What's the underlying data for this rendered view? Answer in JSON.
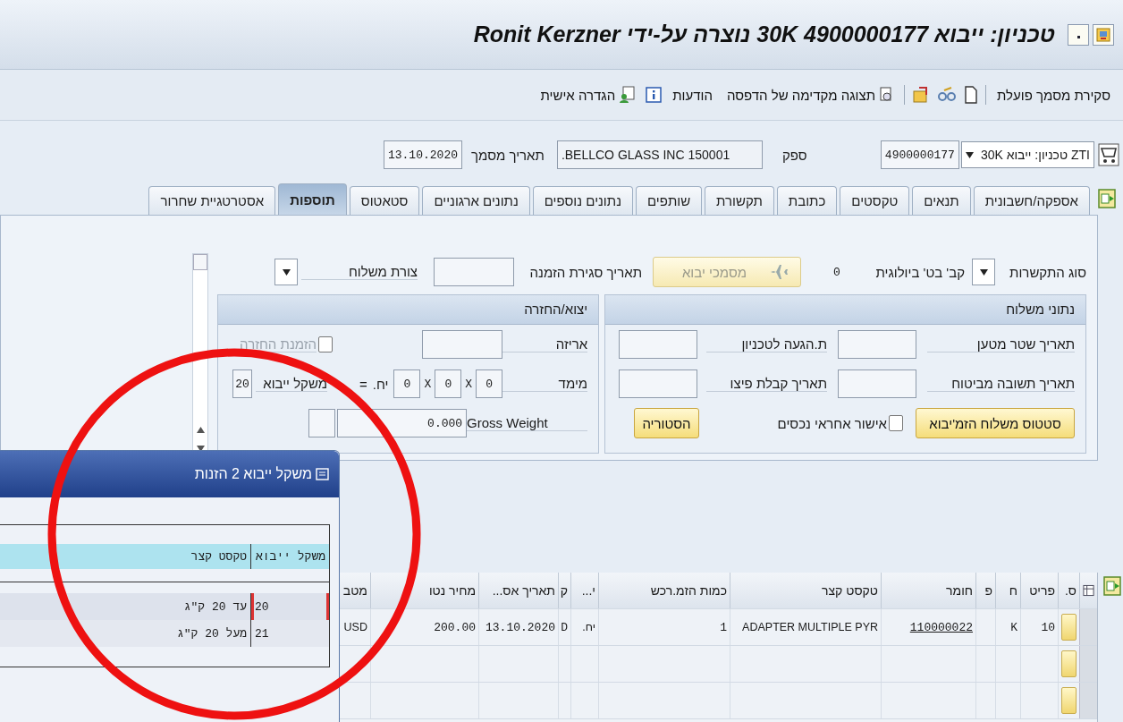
{
  "window": {
    "title": "טכניון: ייבוא 30K 4900000177 נוצרה על-ידי Ronit Kerzner"
  },
  "toolbar": {
    "document_overview": "סקירת מסמך פועלת",
    "print_preview": "תצוגה מקדימה של הדפסה",
    "messages": "הודעות",
    "personal_setting": "הגדרה אישית"
  },
  "header": {
    "doc_type": "ZTI טכניון: ייבוא 30K",
    "doc_number": "4900000177",
    "vendor_label": "ספק",
    "vendor": ".BELLCO GLASS INC 150001",
    "date_label": "תאריך מסמך",
    "date": "13.10.2020"
  },
  "tabs": [
    {
      "label": "אספקה/חשבונית",
      "selected": false
    },
    {
      "label": "תנאים",
      "selected": false
    },
    {
      "label": "טקסטים",
      "selected": false
    },
    {
      "label": "כתובת",
      "selected": false
    },
    {
      "label": "תקשורת",
      "selected": false
    },
    {
      "label": "שותפים",
      "selected": false
    },
    {
      "label": "נתונים נוספים",
      "selected": false
    },
    {
      "label": "נתונים ארגוניים",
      "selected": false
    },
    {
      "label": "סטאטוס",
      "selected": false
    },
    {
      "label": "תוספות",
      "selected": true
    },
    {
      "label": "אסטרטגיית שחרור",
      "selected": false
    }
  ],
  "panel": {
    "top_row": {
      "contract_type_label": "סוג התקשרות",
      "bio_label": "קב' בט' ביולוגית",
      "count": "0",
      "import_docs_button": {
        "label": "מסמכי יבוא",
        "disabled": true
      },
      "closing_date_label": "תאריך סגירת הזמנה",
      "shipping_form_label": "צורת משלוח"
    },
    "shipping_group": {
      "title": "נתוני משלוח",
      "bill_of_lading_date": "תאריך שטר מטען",
      "arrival_date": "ת.הגעה לטכניון",
      "insurance_reply_date": "תאריך תשובה מביטוח",
      "compensation_date": "תאריך קבלת פיצו",
      "status_button": "סטטוס משלוח הזמ'יבוא",
      "asset_approval": {
        "label": "אישור אחראי נכסים",
        "checked": false
      },
      "history_button": "הסטוריה"
    },
    "export_group": {
      "title": "יצוא/החזרה",
      "packaging": "אריזה",
      "return_order": {
        "label": "הזמנת החזרה",
        "checked": false,
        "disabled": true
      },
      "dimension": "מימד",
      "dims": [
        "0",
        "0",
        "0"
      ],
      "dim_separators": [
        "X",
        "X"
      ],
      "unit": "יח.",
      "equals": "=",
      "import_weight_label": "משקל ייבוא",
      "import_weight": "20",
      "gross_weight_label": "Gross Weight",
      "gross_weight": "0.000"
    }
  },
  "items_table": {
    "columns": [
      {
        "label": "ס.",
        "kind": "status"
      },
      {
        "label": "פריט",
        "kind": "mono"
      },
      {
        "label": "ח",
        "kind": "mono"
      },
      {
        "label": "פ",
        "kind": "mono"
      },
      {
        "label": "חומר",
        "kind": "link"
      },
      {
        "label": "טקסט קצר",
        "kind": "text"
      },
      {
        "label": "כמות הזמ.רכש",
        "kind": "mono"
      },
      {
        "label": "י...",
        "kind": "text"
      },
      {
        "label": "ק",
        "kind": "mono"
      },
      {
        "label": "תאריך אס...",
        "kind": "mono"
      },
      {
        "label": "מחיר נטו",
        "kind": "mono"
      },
      {
        "label": "מטב",
        "kind": "text"
      }
    ],
    "rows": [
      [
        null,
        "10",
        "K",
        null,
        "110000022",
        "ADAPTER MULTIPLE PYR",
        "1",
        "יח.",
        "D",
        "13.10.2020",
        "200.00",
        "USD"
      ]
    ]
  },
  "popup": {
    "title": "משקל ייבוא 2 הזנות",
    "columns": [
      "משקל ייבוא",
      "טקסט קצר"
    ],
    "rows": [
      {
        "weight": "20",
        "text": "עד 20 ק\"ג",
        "selected": true
      },
      {
        "weight": "21",
        "text": "מעל 20 ק\"ג",
        "selected": false
      }
    ]
  }
}
